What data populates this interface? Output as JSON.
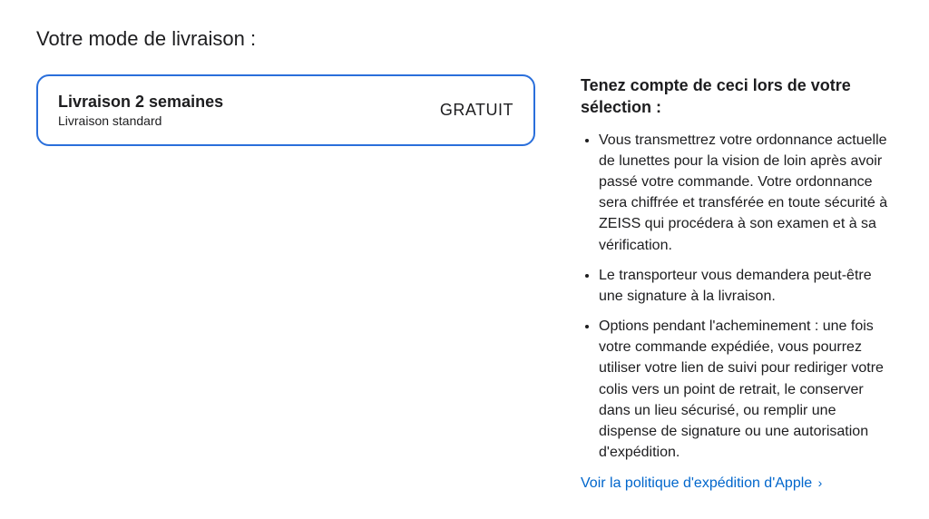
{
  "section": {
    "title": "Votre mode de livraison :"
  },
  "shipping": {
    "option": {
      "title": "Livraison 2 semaines",
      "subtitle": "Livraison standard",
      "price": "GRATUIT"
    }
  },
  "info": {
    "title": "Tenez compte de ceci lors de votre sélection :",
    "bullets": [
      "Vous transmettrez votre ordonnance actuelle de lunettes pour la vision de loin après avoir passé votre commande. Votre ordonnance sera chiffrée et transférée en toute sécurité à ZEISS qui procédera à son examen et à sa vérification.",
      "Le transporteur vous demandera peut-être une signature à la livraison.",
      "Options pendant l'acheminement : une fois votre commande expédiée, vous pourrez utiliser votre lien de suivi pour rediriger votre colis vers un point de retrait, le conserver dans un lieu sécurisé, ou remplir une dispense de signature ou une autorisation d'expédition."
    ],
    "link": {
      "text": "Voir la politique d'expédition d'Apple",
      "chevron": "›"
    }
  }
}
